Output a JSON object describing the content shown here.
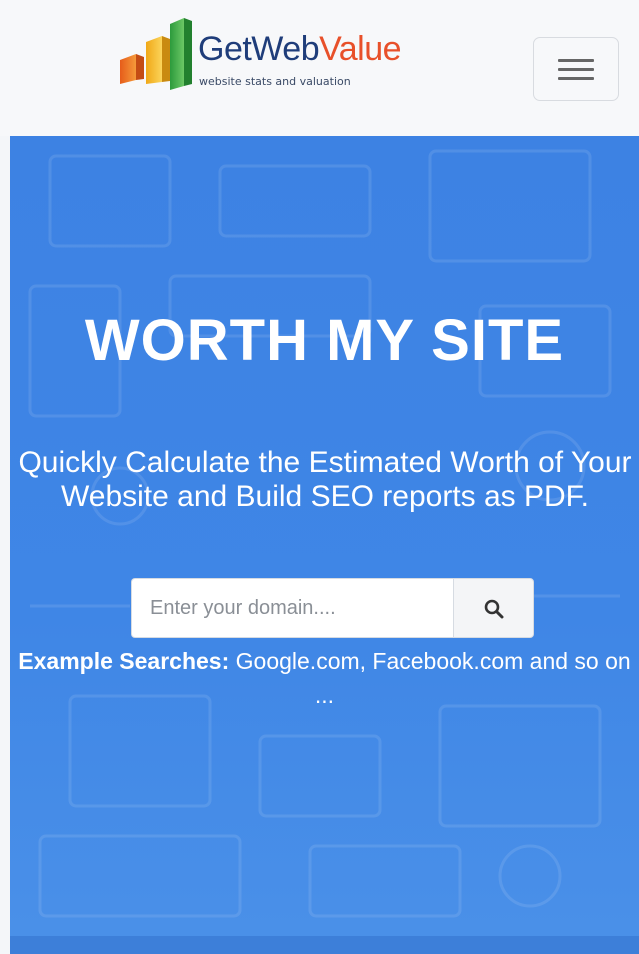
{
  "navbar": {
    "logo": {
      "brand_part1": "GetWeb",
      "brand_part2": "Value",
      "tagline": "website stats and valuation",
      "colors": {
        "brand_dark": "#1f3d7a",
        "brand_accent": "#e8502a",
        "bar_orange": "#f07a24",
        "bar_yellow": "#f5b81c",
        "bar_green": "#3aa844"
      }
    },
    "menu_button_icon": "hamburger-menu-icon"
  },
  "hero": {
    "title": "WORTH MY SITE",
    "subtitle": "Quickly Calculate the Estimated Worth of Your Website and Build SEO reports as PDF.",
    "search": {
      "placeholder": "Enter your domain....",
      "value": "",
      "button_icon": "search-icon"
    },
    "examples": {
      "label": "Example Searches:",
      "text": "Google.com, Facebook.com and so on ..."
    },
    "colors": {
      "background": "#3f86e6",
      "text": "#ffffff"
    }
  }
}
